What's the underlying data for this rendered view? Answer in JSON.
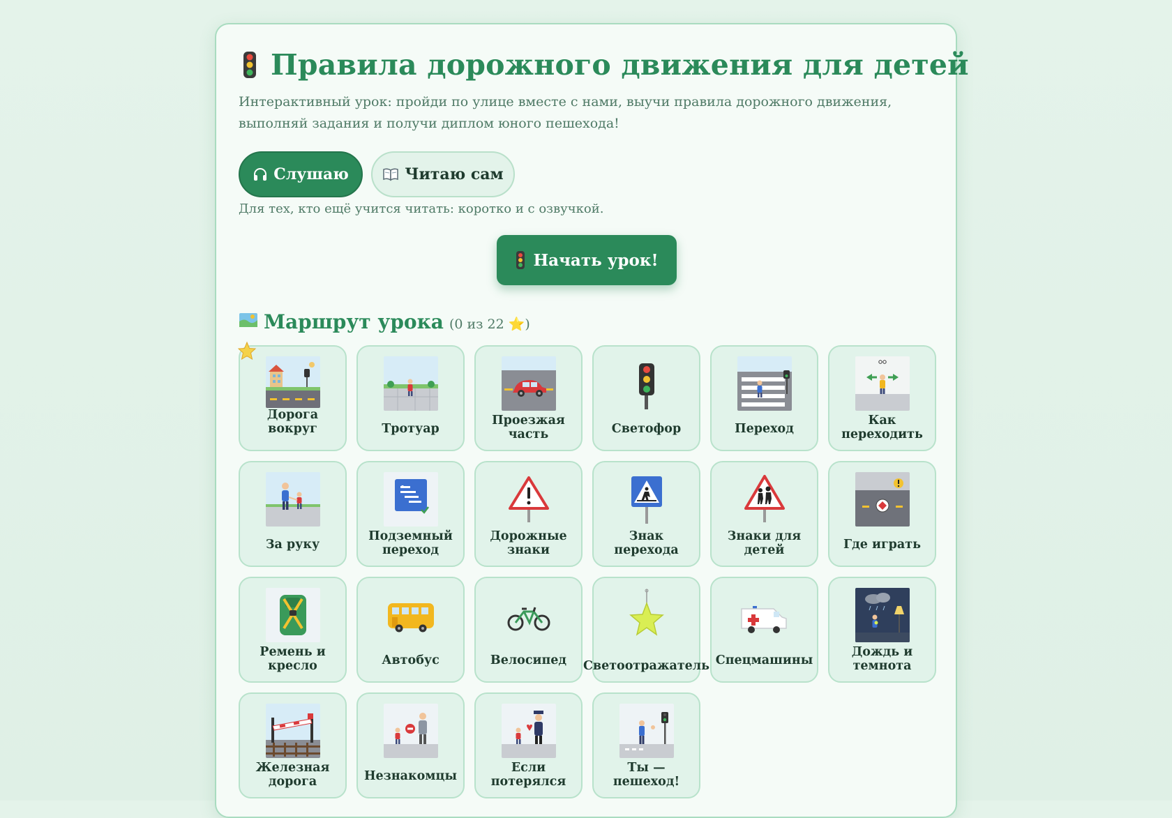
{
  "header": {
    "title": "Правила дорожного движения для детей",
    "subtitle": "Интерактивный урок: пройди по улице вместе с нами, выучи правила дорожного движения, выполняй задания и получи диплом юного пешехода!"
  },
  "modes": {
    "listen_label": "Слушаю",
    "read_label": "Читаю сам",
    "hint": "Для тех, кто ещё учится читать: коротко и с озвучкой."
  },
  "start_button": {
    "label": "Начать урок!"
  },
  "route": {
    "title": "Маршрут урока",
    "progress": "(0 из 22 ⭐)",
    "done": 0,
    "total": 22,
    "tiles": [
      {
        "label": "Дорога вокруг",
        "icon": "street-scene-icon"
      },
      {
        "label": "Тротуар",
        "icon": "sidewalk-icon"
      },
      {
        "label": "Проезжая часть",
        "icon": "car-road-icon"
      },
      {
        "label": "Светофор",
        "icon": "traffic-light-icon"
      },
      {
        "label": "Переход",
        "icon": "crosswalk-icon"
      },
      {
        "label": "Как переходить",
        "icon": "look-both-ways-icon"
      },
      {
        "label": "За руку",
        "icon": "hold-hands-icon"
      },
      {
        "label": "Подземный переход",
        "icon": "underpass-sign-icon"
      },
      {
        "label": "Дорожные знаки",
        "icon": "warning-sign-icon"
      },
      {
        "label": "Знак перехода",
        "icon": "pedestrian-sign-icon"
      },
      {
        "label": "Знаки для детей",
        "icon": "children-sign-icon"
      },
      {
        "label": "Где играть",
        "icon": "play-place-icon"
      },
      {
        "label": "Ремень и кресло",
        "icon": "seat-belt-icon"
      },
      {
        "label": "Автобус",
        "icon": "bus-icon"
      },
      {
        "label": "Велосипед",
        "icon": "bicycle-icon"
      },
      {
        "label": "Светоотражатель",
        "icon": "reflector-icon"
      },
      {
        "label": "Спецмашины",
        "icon": "ambulance-icon"
      },
      {
        "label": "Дождь и темнота",
        "icon": "rain-night-icon"
      },
      {
        "label": "Железная дорога",
        "icon": "railway-icon"
      },
      {
        "label": "Незнакомцы",
        "icon": "stranger-icon"
      },
      {
        "label": "Если потерялся",
        "icon": "lost-child-icon"
      },
      {
        "label": "Ты — пешеход!",
        "icon": "pedestrian-final-icon"
      }
    ]
  },
  "colors": {
    "accent": "#2b8a5a",
    "tile_bg": "#e1f3ea",
    "tile_border": "#b8e2cb",
    "text_muted": "#4f7a66"
  }
}
